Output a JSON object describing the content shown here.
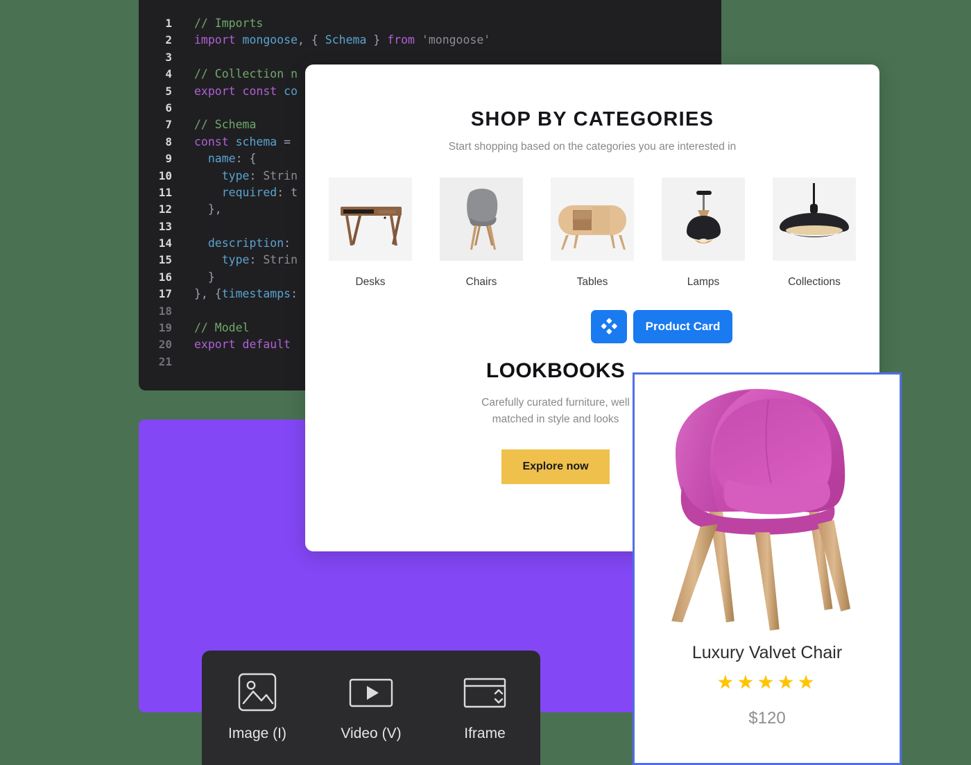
{
  "background_color": "#4a7152",
  "code_editor": {
    "name": "code-editor-panel",
    "background": "#1f1f22",
    "lines": [
      {
        "n": "1",
        "tokens": [
          {
            "t": "// Imports",
            "c": "tok-comment"
          }
        ]
      },
      {
        "n": "2",
        "tokens": [
          {
            "t": "import",
            "c": "tok-keyword"
          },
          {
            "t": " ",
            "c": "tok-plain"
          },
          {
            "t": "mongoose",
            "c": "tok-ident"
          },
          {
            "t": ", { ",
            "c": "tok-punct"
          },
          {
            "t": "Schema",
            "c": "tok-ident"
          },
          {
            "t": " } ",
            "c": "tok-punct"
          },
          {
            "t": "from",
            "c": "tok-keyword"
          },
          {
            "t": " ",
            "c": "tok-plain"
          },
          {
            "t": "'mongoose'",
            "c": "tok-string"
          }
        ]
      },
      {
        "n": "3",
        "tokens": []
      },
      {
        "n": "4",
        "tokens": [
          {
            "t": "// Collection n",
            "c": "tok-comment"
          }
        ]
      },
      {
        "n": "5",
        "tokens": [
          {
            "t": "export",
            "c": "tok-keyword"
          },
          {
            "t": " ",
            "c": "tok-plain"
          },
          {
            "t": "const",
            "c": "tok-keyword"
          },
          {
            "t": " ",
            "c": "tok-plain"
          },
          {
            "t": "co",
            "c": "tok-ident"
          }
        ]
      },
      {
        "n": "6",
        "tokens": []
      },
      {
        "n": "7",
        "tokens": [
          {
            "t": "// Schema",
            "c": "tok-comment"
          }
        ]
      },
      {
        "n": "8",
        "tokens": [
          {
            "t": "const",
            "c": "tok-keyword"
          },
          {
            "t": " ",
            "c": "tok-plain"
          },
          {
            "t": "schema",
            "c": "tok-ident"
          },
          {
            "t": " = ",
            "c": "tok-punct"
          }
        ]
      },
      {
        "n": "9",
        "tokens": [
          {
            "t": "  name",
            "c": "tok-prop"
          },
          {
            "t": ": {",
            "c": "tok-punct"
          }
        ]
      },
      {
        "n": "10",
        "tokens": [
          {
            "t": "    type",
            "c": "tok-prop"
          },
          {
            "t": ": ",
            "c": "tok-punct"
          },
          {
            "t": "Strin",
            "c": "tok-string"
          }
        ]
      },
      {
        "n": "11",
        "tokens": [
          {
            "t": "    required",
            "c": "tok-prop"
          },
          {
            "t": ": t",
            "c": "tok-punct"
          }
        ]
      },
      {
        "n": "12",
        "tokens": [
          {
            "t": "  },",
            "c": "tok-punct"
          }
        ]
      },
      {
        "n": "13",
        "tokens": []
      },
      {
        "n": "14",
        "tokens": [
          {
            "t": "  description",
            "c": "tok-prop"
          },
          {
            "t": ":",
            "c": "tok-punct"
          }
        ]
      },
      {
        "n": "15",
        "tokens": [
          {
            "t": "    type",
            "c": "tok-prop"
          },
          {
            "t": ": ",
            "c": "tok-punct"
          },
          {
            "t": "Strin",
            "c": "tok-string"
          }
        ]
      },
      {
        "n": "16",
        "tokens": [
          {
            "t": "  }",
            "c": "tok-punct"
          }
        ]
      },
      {
        "n": "17",
        "tokens": [
          {
            "t": "}, {",
            "c": "tok-punct"
          },
          {
            "t": "timestamps",
            "c": "tok-prop"
          },
          {
            "t": ":",
            "c": "tok-punct"
          }
        ]
      },
      {
        "n": "18",
        "tokens": []
      },
      {
        "n": "19",
        "tokens": [
          {
            "t": "// Model",
            "c": "tok-comment"
          }
        ]
      },
      {
        "n": "20",
        "tokens": [
          {
            "t": "export",
            "c": "tok-keyword"
          },
          {
            "t": " ",
            "c": "tok-plain"
          },
          {
            "t": "default",
            "c": "tok-keyword"
          }
        ]
      },
      {
        "n": "21",
        "tokens": []
      }
    ],
    "active_lines": [
      "1",
      "2",
      "3",
      "4",
      "5",
      "6",
      "7",
      "8",
      "9",
      "10",
      "11",
      "12",
      "13",
      "14",
      "15",
      "16",
      "17"
    ]
  },
  "shop_panel": {
    "title": "SHOP BY CATEGORIES",
    "subtitle": "Start shopping based on the categories you are interested in",
    "categories": [
      {
        "label": "Desks",
        "icon": "desk-thumbnail"
      },
      {
        "label": "Chairs",
        "icon": "chair-thumbnail"
      },
      {
        "label": "Tables",
        "icon": "sideboard-thumbnail"
      },
      {
        "label": "Lamps",
        "icon": "pendant-lamp-thumbnail"
      },
      {
        "label": "Collections",
        "icon": "flat-pendant-lamp-thumbnail"
      }
    ],
    "toolbar": {
      "drag_handle_icon": "four-diamonds-icon",
      "component_label": "Product Card",
      "accent_color": "#1a7af0"
    },
    "lookbooks": {
      "title": "LOOKBOOKS",
      "subtitle_line1": "Carefully curated furniture, well",
      "subtitle_line2": "matched in style and looks",
      "cta_label": "Explore now",
      "cta_color": "#efc14c"
    }
  },
  "purple_panel": {
    "name": "purple-canvas-block",
    "color": "#8347f5"
  },
  "product_card": {
    "border_color": "#4f6fe8",
    "image_alt": "pink-velvet-armchair",
    "name": "Luxury Valvet Chair",
    "rating": 5,
    "rating_max": 5,
    "stars": "★★★★★",
    "star_color": "#ffc400",
    "price": "$120"
  },
  "insert_toolbar": {
    "background": "#2b2b2e",
    "items": [
      {
        "label": "Image (I)",
        "icon": "image-icon"
      },
      {
        "label": "Video (V)",
        "icon": "video-play-icon"
      },
      {
        "label": "Iframe",
        "icon": "iframe-icon"
      }
    ]
  }
}
